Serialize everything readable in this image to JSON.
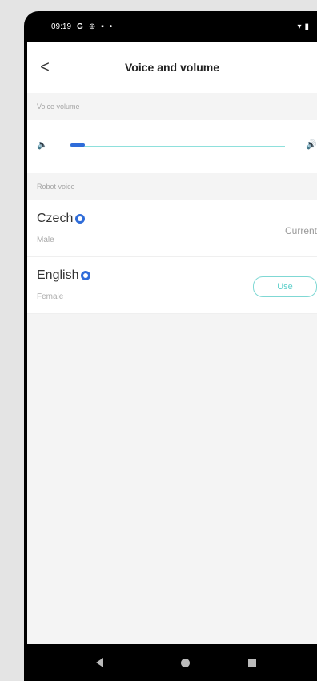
{
  "statusbar": {
    "time": "09:19",
    "icons": [
      "google-icon",
      "vpn-icon",
      "sim-icon",
      "dot-icon"
    ],
    "right_icons": [
      "wifi-icon",
      "battery-icon"
    ]
  },
  "appbar": {
    "back_glyph": "<",
    "title": "Voice and volume"
  },
  "volume": {
    "section_label": "Voice volume",
    "level_fraction": 0.05
  },
  "voices": {
    "section_label": "Robot voice",
    "items": [
      {
        "name": "Czech",
        "gender": "Male",
        "status": "Current"
      },
      {
        "name": "English",
        "gender": "Female",
        "action": "Use"
      }
    ]
  },
  "colors": {
    "accent_teal": "#5ccfca",
    "accent_blue": "#2f6cd9"
  }
}
